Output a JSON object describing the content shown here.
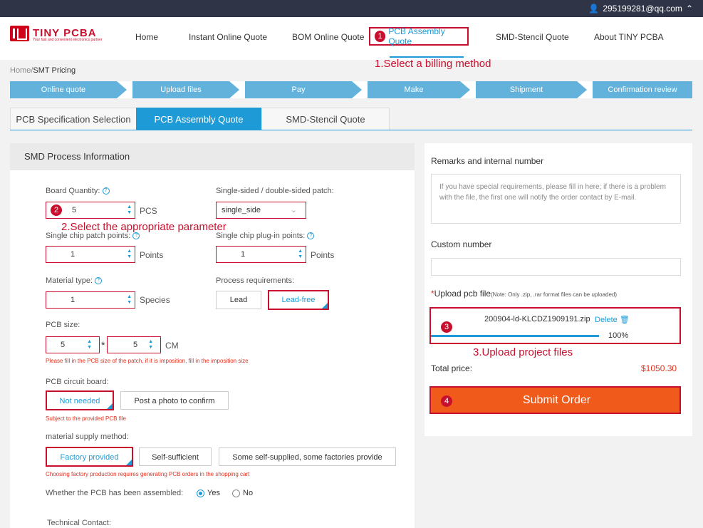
{
  "topbar": {
    "account": "295199281@qq.com"
  },
  "logo": {
    "name": "TINY PCBA",
    "tagline": "Your fast and convenient electronics partner"
  },
  "nav": {
    "home": "Home",
    "instant": "Instant Online Quote",
    "bom": "BOM Online Quote",
    "pcba": "PCB Assembly Quote",
    "stencil": "SMD-Stencil Quote",
    "about": "About TINY PCBA",
    "badge1": "1"
  },
  "annotations": {
    "a1": "1.Select a billing method",
    "a2": "2.Select the appropriate parameter",
    "a3": "3.Upload project files",
    "b2": "2",
    "b3": "3",
    "b4": "4"
  },
  "breadcrumb": {
    "home": "Home/",
    "current": "SMT Pricing"
  },
  "steps": [
    "Online quote",
    "Upload files",
    "Pay",
    "Make",
    "Shipment",
    "Confirmation review"
  ],
  "tabs": {
    "spec": "PCB Specification Selection",
    "pcba": "PCB Assembly Quote",
    "stencil": "SMD-Stencil Quote"
  },
  "left": {
    "title": "SMD Process Information",
    "board_qty_label": "Board Quantity:",
    "board_qty": "5",
    "pcs": "PCS",
    "sides_label": "Single-sided / double-sided patch:",
    "sides": "single_side",
    "patch_label": "Single chip patch points:",
    "patch": "1",
    "points": "Points",
    "plugin_label": "Single chip plug-in points:",
    "plugin": "1",
    "points2": "Points",
    "material_label": "Material type:",
    "material": "1",
    "species": "Species",
    "process_label": "Process requirements:",
    "lead": "Lead",
    "leadfree": "Lead-free",
    "size_label": "PCB size:",
    "w": "5",
    "h": "5",
    "star": "*",
    "cm": "CM",
    "size_note": "Please fill in the PCB size of the patch, if it is imposition, fill in the imposition size",
    "circuit_label": "PCB circuit board:",
    "not_needed": "Not needed",
    "photo": "Post a photo to confirm",
    "circuit_note": "Subject to the provided PCB file",
    "supply_label": "material supply method:",
    "factory": "Factory provided",
    "self": "Self-sufficient",
    "some": "Some self-supplied, some factories provide",
    "supply_note": "Choosing factory production requires generating PCB orders in the shopping cart",
    "assembled_label": "Whether the PCB has been assembled:",
    "yes": "Yes",
    "no": "No",
    "tech": "Technical Contact:"
  },
  "right": {
    "remarks_label": "Remarks and internal number",
    "remarks_placeholder": "If you have special requirements, please fill in here; if there is a problem with the file, the first one will notify the order contact by E-mail.",
    "custom_label": "Custom number",
    "upload_star": "*",
    "upload_label": "Upload pcb file",
    "upload_note": "(Note: Only .zip, .rar format files can be uploaded)",
    "file": "200904-ld-KLCDZ1909191.zip",
    "delete": "Delete",
    "progress": "100%",
    "progress_value": 1.0,
    "total_label": "Total price:",
    "total": "$1050.30",
    "submit": "Submit Order"
  }
}
